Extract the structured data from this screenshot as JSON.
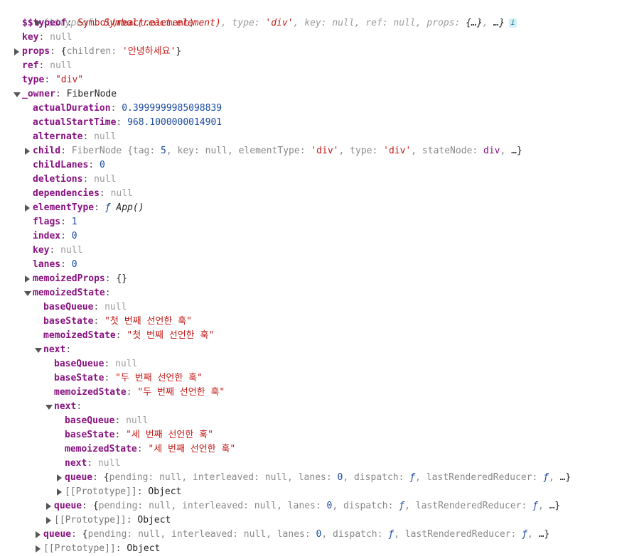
{
  "root": {
    "preview_prefix": "{$$typeof: ",
    "preview_symbol": "Symbol(react.element)",
    "preview_mid1": ", type: ",
    "preview_type": "'div'",
    "preview_mid2": ", key: null, ref: null, props: ",
    "preview_props": "{…}",
    "preview_mid3": ", ",
    "preview_end": "…}",
    "info_icon": "i"
  },
  "rows": [
    {
      "indent": 1,
      "toggle": "none",
      "key": "$$typeof",
      "vtype": "sym",
      "value": "Symbol(react.element)"
    },
    {
      "indent": 1,
      "toggle": "none",
      "key": "key",
      "vtype": "null",
      "value": "null"
    },
    {
      "indent": 1,
      "toggle": "right",
      "key": "props",
      "vtype": "preview",
      "parts": [
        {
          "c": "plain",
          "t": "{"
        },
        {
          "c": "gray",
          "t": "children: "
        },
        {
          "c": "str",
          "t": "'안녕하세요'"
        },
        {
          "c": "plain",
          "t": "}"
        }
      ]
    },
    {
      "indent": 1,
      "toggle": "none",
      "key": "ref",
      "vtype": "null",
      "value": "null"
    },
    {
      "indent": 1,
      "toggle": "none",
      "key": "type",
      "vtype": "str",
      "value": "\"div\""
    },
    {
      "indent": 1,
      "toggle": "down",
      "key": "_owner",
      "vtype": "plain",
      "value": "FiberNode"
    },
    {
      "indent": 2,
      "toggle": "none",
      "key": "actualDuration",
      "vtype": "num",
      "value": "0.3999999985098839"
    },
    {
      "indent": 2,
      "toggle": "none",
      "key": "actualStartTime",
      "vtype": "num",
      "value": "968.1000000014901"
    },
    {
      "indent": 2,
      "toggle": "none",
      "key": "alternate",
      "vtype": "null",
      "value": "null"
    },
    {
      "indent": 2,
      "toggle": "right",
      "key": "child",
      "vtype": "preview",
      "parts": [
        {
          "c": "gray",
          "t": "FiberNode {tag: "
        },
        {
          "c": "num",
          "t": "5"
        },
        {
          "c": "gray",
          "t": ", key: null, elementType: "
        },
        {
          "c": "str",
          "t": "'div'"
        },
        {
          "c": "gray",
          "t": ", type: "
        },
        {
          "c": "str",
          "t": "'div'"
        },
        {
          "c": "gray",
          "t": ", stateNode: "
        },
        {
          "c": "elem",
          "t": "div"
        },
        {
          "c": "gray",
          "t": ", "
        },
        {
          "c": "plain",
          "t": "…}"
        }
      ]
    },
    {
      "indent": 2,
      "toggle": "none",
      "key": "childLanes",
      "vtype": "num",
      "value": "0"
    },
    {
      "indent": 2,
      "toggle": "none",
      "key": "deletions",
      "vtype": "null",
      "value": "null"
    },
    {
      "indent": 2,
      "toggle": "none",
      "key": "dependencies",
      "vtype": "null",
      "value": "null"
    },
    {
      "indent": 2,
      "toggle": "right",
      "key": "elementType",
      "vtype": "preview",
      "parts": [
        {
          "c": "fn",
          "t": "ƒ "
        },
        {
          "c": "fnname",
          "t": "App()"
        }
      ]
    },
    {
      "indent": 2,
      "toggle": "none",
      "key": "flags",
      "vtype": "num",
      "value": "1"
    },
    {
      "indent": 2,
      "toggle": "none",
      "key": "index",
      "vtype": "num",
      "value": "0"
    },
    {
      "indent": 2,
      "toggle": "none",
      "key": "key",
      "vtype": "null",
      "value": "null"
    },
    {
      "indent": 2,
      "toggle": "none",
      "key": "lanes",
      "vtype": "num",
      "value": "0"
    },
    {
      "indent": 2,
      "toggle": "right",
      "key": "memoizedProps",
      "vtype": "plain",
      "value": "{}"
    },
    {
      "indent": 2,
      "toggle": "down",
      "key": "memoizedState",
      "vtype": "empty",
      "value": ""
    },
    {
      "indent": 3,
      "toggle": "none",
      "key": "baseQueue",
      "vtype": "null",
      "value": "null"
    },
    {
      "indent": 3,
      "toggle": "none",
      "key": "baseState",
      "vtype": "str",
      "value": "\"첫 번째 선언한 훅\""
    },
    {
      "indent": 3,
      "toggle": "none",
      "key": "memoizedState",
      "vtype": "str",
      "value": "\"첫 번째 선언한 훅\""
    },
    {
      "indent": 3,
      "toggle": "down",
      "key": "next",
      "vtype": "empty",
      "value": ""
    },
    {
      "indent": 4,
      "toggle": "none",
      "key": "baseQueue",
      "vtype": "null",
      "value": "null"
    },
    {
      "indent": 4,
      "toggle": "none",
      "key": "baseState",
      "vtype": "str",
      "value": "\"두 번째 선언한 훅\""
    },
    {
      "indent": 4,
      "toggle": "none",
      "key": "memoizedState",
      "vtype": "str",
      "value": "\"두 번째 선언한 훅\""
    },
    {
      "indent": 4,
      "toggle": "down",
      "key": "next",
      "vtype": "empty",
      "value": ""
    },
    {
      "indent": 5,
      "toggle": "none",
      "key": "baseQueue",
      "vtype": "null",
      "value": "null"
    },
    {
      "indent": 5,
      "toggle": "none",
      "key": "baseState",
      "vtype": "str",
      "value": "\"세 번째 선언한 훅\""
    },
    {
      "indent": 5,
      "toggle": "none",
      "key": "memoizedState",
      "vtype": "str",
      "value": "\"세 번째 선언한 훅\""
    },
    {
      "indent": 5,
      "toggle": "none",
      "key": "next",
      "vtype": "null",
      "value": "null"
    },
    {
      "indent": 5,
      "toggle": "right",
      "key": "queue",
      "vtype": "preview",
      "parts": [
        {
          "c": "plain",
          "t": "{"
        },
        {
          "c": "gray",
          "t": "pending: null, interleaved: null, lanes: "
        },
        {
          "c": "num",
          "t": "0"
        },
        {
          "c": "gray",
          "t": ", dispatch: "
        },
        {
          "c": "fn",
          "t": "ƒ"
        },
        {
          "c": "gray",
          "t": ", lastRenderedReducer: "
        },
        {
          "c": "fn",
          "t": "ƒ"
        },
        {
          "c": "gray",
          "t": ", "
        },
        {
          "c": "plain",
          "t": "…}"
        }
      ]
    },
    {
      "indent": 5,
      "toggle": "right",
      "key": "[[Prototype]]",
      "proto": true,
      "vtype": "plain",
      "value": "Object"
    },
    {
      "indent": 4,
      "toggle": "right",
      "key": "queue",
      "vtype": "preview",
      "parts": [
        {
          "c": "plain",
          "t": "{"
        },
        {
          "c": "gray",
          "t": "pending: null, interleaved: null, lanes: "
        },
        {
          "c": "num",
          "t": "0"
        },
        {
          "c": "gray",
          "t": ", dispatch: "
        },
        {
          "c": "fn",
          "t": "ƒ"
        },
        {
          "c": "gray",
          "t": ", lastRenderedReducer: "
        },
        {
          "c": "fn",
          "t": "ƒ"
        },
        {
          "c": "gray",
          "t": ", "
        },
        {
          "c": "plain",
          "t": "…}"
        }
      ]
    },
    {
      "indent": 4,
      "toggle": "right",
      "key": "[[Prototype]]",
      "proto": true,
      "vtype": "plain",
      "value": "Object"
    },
    {
      "indent": 3,
      "toggle": "right",
      "key": "queue",
      "vtype": "preview",
      "parts": [
        {
          "c": "plain",
          "t": "{"
        },
        {
          "c": "gray",
          "t": "pending: null, interleaved: null, lanes: "
        },
        {
          "c": "num",
          "t": "0"
        },
        {
          "c": "gray",
          "t": ", dispatch: "
        },
        {
          "c": "fn",
          "t": "ƒ"
        },
        {
          "c": "gray",
          "t": ", lastRenderedReducer: "
        },
        {
          "c": "fn",
          "t": "ƒ"
        },
        {
          "c": "gray",
          "t": ", "
        },
        {
          "c": "plain",
          "t": "…}"
        }
      ]
    },
    {
      "indent": 3,
      "toggle": "right",
      "key": "[[Prototype]]",
      "proto": true,
      "vtype": "plain",
      "value": "Object"
    }
  ]
}
